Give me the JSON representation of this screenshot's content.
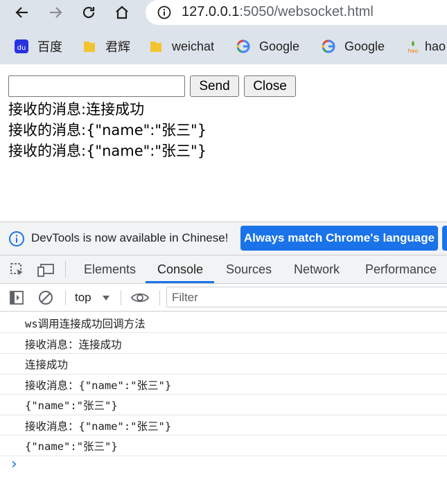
{
  "browser": {
    "url_host": "127.0.0.1",
    "url_rest": ":5050/websocket.html",
    "bookmarks": [
      {
        "label": "百度",
        "icon": "baidu-icon"
      },
      {
        "label": "君辉",
        "icon": "folder-icon"
      },
      {
        "label": "weichat",
        "icon": "folder-icon"
      },
      {
        "label": "Google",
        "icon": "google-icon"
      },
      {
        "label": "Google",
        "icon": "google-icon"
      },
      {
        "label": "hao",
        "icon": "hao-icon"
      }
    ]
  },
  "page": {
    "input_value": "",
    "send_label": "Send",
    "close_label": "Close",
    "messages": [
      "接收的消息:连接成功",
      "接收的消息:{\"name\":\"张三\"}",
      "接收的消息:{\"name\":\"张三\"}"
    ]
  },
  "devtools": {
    "infobar_text": "DevTools is now available in Chinese!",
    "infobar_button": "Always match Chrome's language",
    "tabs": [
      "Elements",
      "Console",
      "Sources",
      "Network",
      "Performance"
    ],
    "active_tab": "Console",
    "context": "top",
    "filter_placeholder": "Filter",
    "console_lines": [
      "ws调用连接成功回调方法",
      "接收消息：连接成功",
      "连接成功",
      "接收消息：{\"name\":\"张三\"}",
      "{\"name\":\"张三\"}",
      "接收消息：{\"name\":\"张三\"}",
      "{\"name\":\"张三\"}"
    ],
    "prompt": "›"
  },
  "colors": {
    "accent": "#1a73e8",
    "chrome_bar": "#dde3ea"
  }
}
